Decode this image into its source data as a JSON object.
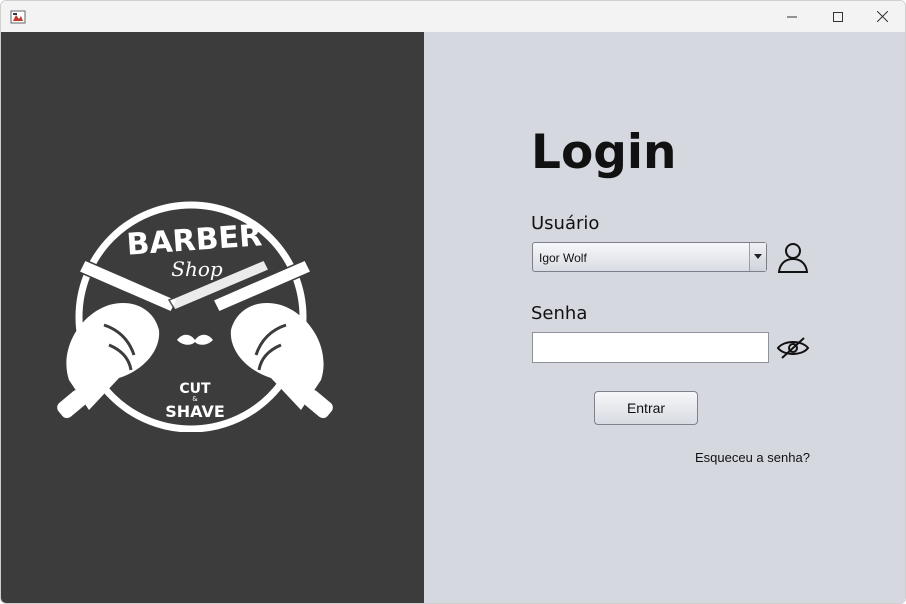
{
  "window": {
    "icon": "java-app-icon",
    "controls": {
      "minimize": "minimize-icon",
      "maximize": "maximize-icon",
      "close": "close-icon"
    }
  },
  "left_panel": {
    "background": "#3c3c3c",
    "logo": {
      "line1": "BARBER",
      "line2": "Shop",
      "line3": "CUT",
      "line4": "&",
      "line5": "SHAVE"
    }
  },
  "login": {
    "title": "Login",
    "user_label": "Usuário",
    "user_selected": "Igor Wolf",
    "user_icon": "user-icon",
    "password_label": "Senha",
    "password_value": "",
    "eye_icon": "eye-slash-icon",
    "submit_label": "Entrar",
    "forgot_label": "Esqueceu a senha?"
  },
  "colors": {
    "right_bg": "#d6d8e0",
    "left_bg": "#3c3c3c"
  }
}
